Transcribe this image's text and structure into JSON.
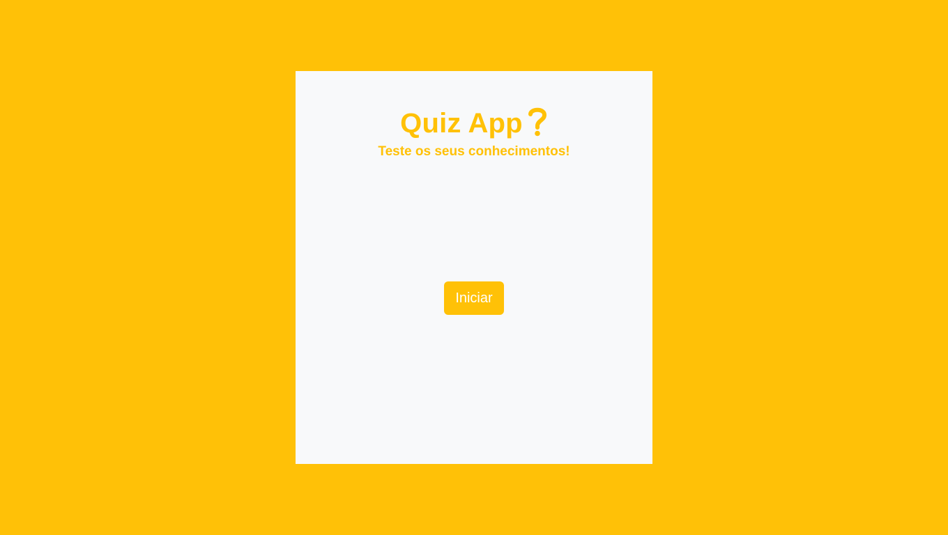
{
  "app": {
    "title": "Quiz App",
    "title_icon": "question-mark-icon",
    "subtitle": "Teste os seus conhecimentos!"
  },
  "actions": {
    "start_label": "Iniciar"
  },
  "colors": {
    "background": "#ffc107",
    "card": "#f8f9fa",
    "accent": "#ffc107",
    "button_text": "#ffffff"
  }
}
